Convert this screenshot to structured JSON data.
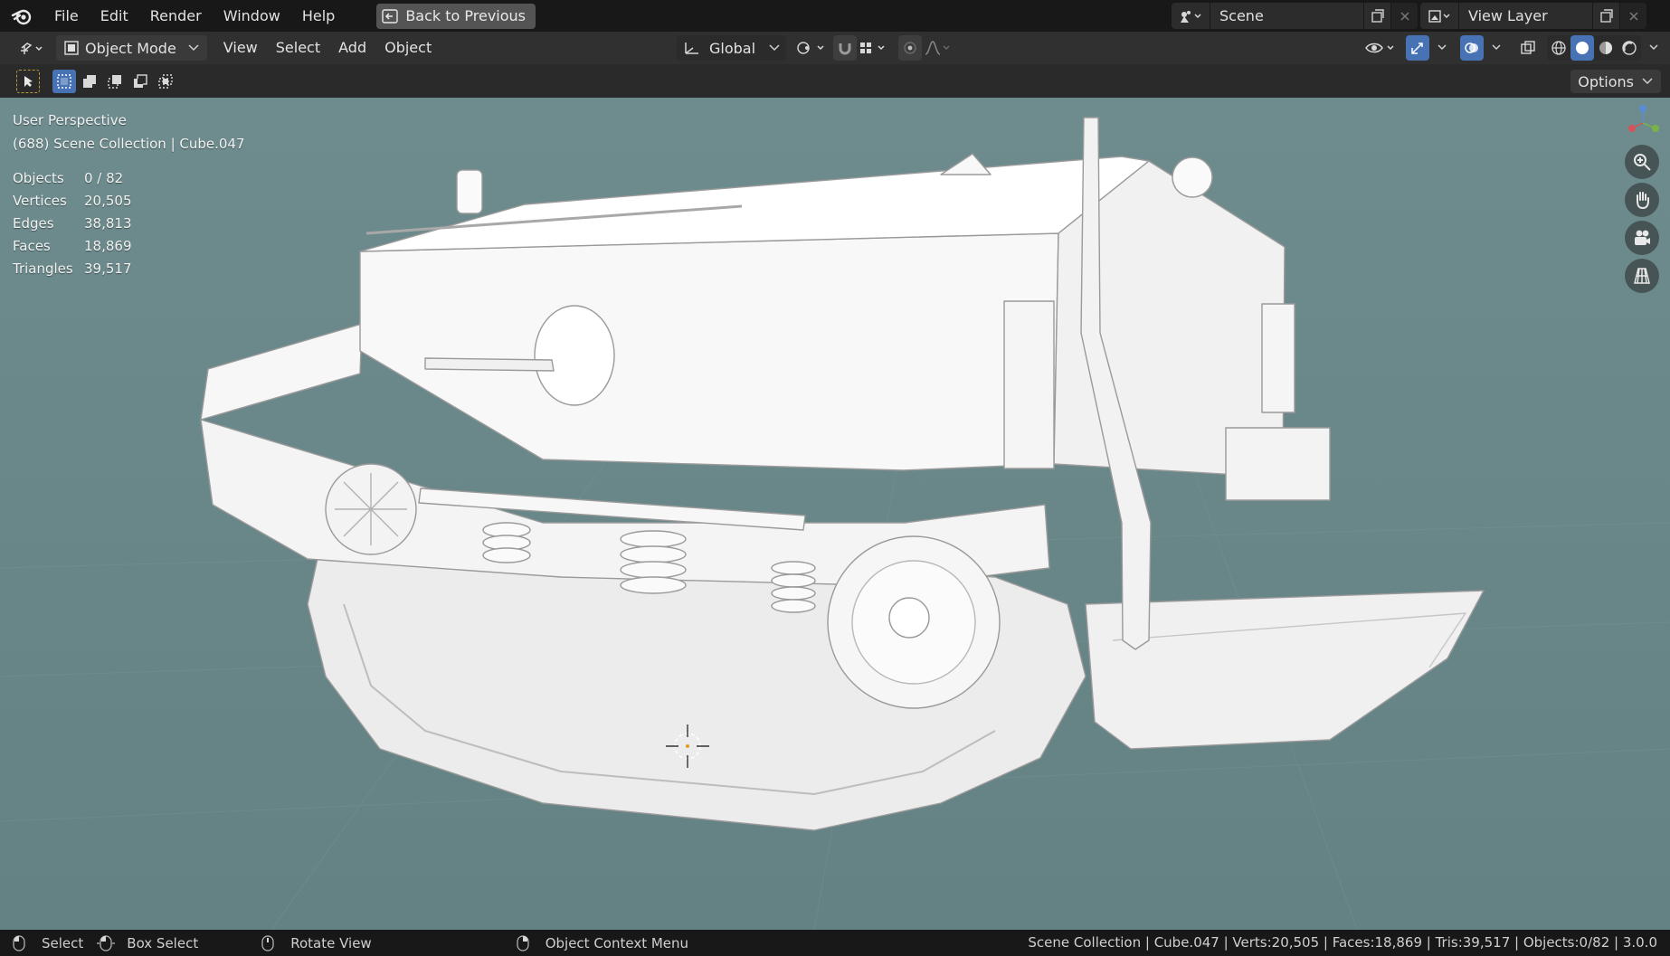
{
  "menubar": {
    "items": [
      "File",
      "Edit",
      "Render",
      "Window",
      "Help"
    ],
    "back_button": "Back to Previous",
    "scene": "Scene",
    "view_layer": "View Layer"
  },
  "header": {
    "mode": "Object Mode",
    "menus": [
      "View",
      "Select",
      "Add",
      "Object"
    ],
    "orientation": "Global"
  },
  "tool_header": {
    "options_label": "Options"
  },
  "viewport": {
    "view_name": "User Perspective",
    "collection": "(688) Scene Collection | Cube.047",
    "stats": [
      {
        "label": "Objects",
        "value": "0 / 82"
      },
      {
        "label": "Vertices",
        "value": "20,505"
      },
      {
        "label": "Edges",
        "value": "38,813"
      },
      {
        "label": "Faces",
        "value": "18,869"
      },
      {
        "label": "Triangles",
        "value": "39,517"
      }
    ],
    "background_color": "#6b8a8c",
    "model_color": "#f2f2f2"
  },
  "statusbar": {
    "hints": [
      "Select",
      "Box Select",
      "Rotate View",
      "Object Context Menu"
    ],
    "info": "Scene Collection | Cube.047 | Verts:20,505 | Faces:18,869 | Tris:39,517 | Objects:0/82 | 3.0.0"
  },
  "colors": {
    "accent": "#4772b3"
  }
}
